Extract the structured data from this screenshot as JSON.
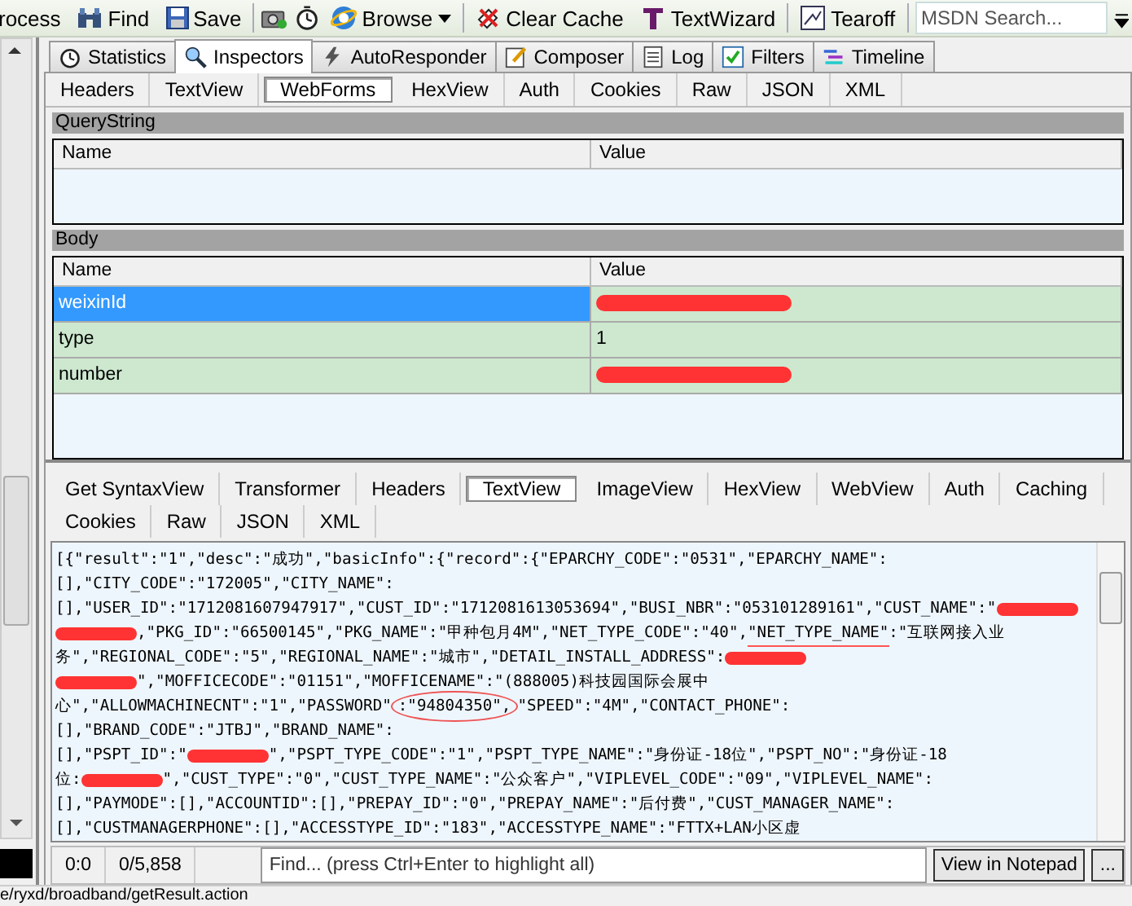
{
  "toolbar": [
    {
      "kind": "button",
      "label": "rocess"
    },
    {
      "kind": "button",
      "label": "Find"
    },
    {
      "kind": "button",
      "label": "Save"
    },
    {
      "kind": "icon"
    },
    {
      "kind": "icon"
    },
    {
      "kind": "dropdown",
      "label": "Browse"
    },
    {
      "kind": "button",
      "label": "Clear Cache"
    },
    {
      "kind": "button",
      "label": "TextWizard"
    },
    {
      "kind": "button",
      "label": "Tearoff"
    },
    {
      "kind": "search",
      "placeholder": "MSDN Search..."
    }
  ],
  "main_tabs": [
    {
      "label": "Statistics",
      "selected": false
    },
    {
      "label": "Inspectors",
      "selected": true
    },
    {
      "label": "AutoResponder",
      "selected": false
    },
    {
      "label": "Composer",
      "selected": false
    },
    {
      "label": "Log",
      "selected": false
    },
    {
      "label": "Filters",
      "selected": false
    },
    {
      "label": "Timeline",
      "selected": false
    }
  ],
  "request": {
    "tabs": [
      {
        "label": "Headers",
        "selected": false
      },
      {
        "label": "TextView",
        "selected": false
      },
      {
        "label": "WebForms",
        "selected": true
      },
      {
        "label": "HexView",
        "selected": false
      },
      {
        "label": "Auth",
        "selected": false
      },
      {
        "label": "Cookies",
        "selected": false
      },
      {
        "label": "Raw",
        "selected": false
      },
      {
        "label": "JSON",
        "selected": false
      },
      {
        "label": "XML",
        "selected": false
      }
    ],
    "querystring": {
      "title": "QueryString",
      "columns": [
        "Name",
        "Value"
      ]
    },
    "body": {
      "title": "Body",
      "columns": [
        "Name",
        "Value"
      ],
      "rows": [
        {
          "name": "weixinId",
          "value_redacted": true,
          "selected": true
        },
        {
          "name": "type",
          "value": "1",
          "value_redacted": false,
          "selected": false
        },
        {
          "name": "number",
          "value_redacted": true,
          "selected": false
        }
      ]
    }
  },
  "response": {
    "tabs": [
      [
        {
          "label": "Get SyntaxView",
          "selected": false
        },
        {
          "label": "Transformer",
          "selected": false
        },
        {
          "label": "Headers",
          "selected": false
        },
        {
          "label": "TextView",
          "selected": true
        },
        {
          "label": "ImageView",
          "selected": false
        },
        {
          "label": "HexView",
          "selected": false
        },
        {
          "label": "WebView",
          "selected": false
        },
        {
          "label": "Auth",
          "selected": false
        },
        {
          "label": "Caching",
          "selected": false
        }
      ],
      [
        {
          "label": "Cookies",
          "selected": false
        },
        {
          "label": "Raw",
          "selected": false
        },
        {
          "label": "JSON",
          "selected": false
        },
        {
          "label": "XML",
          "selected": false
        }
      ]
    ],
    "lines": [
      [
        {
          "kind": "text",
          "text": "[{\"result\":\"1\",\"desc\":\"成功\",\"basicInfo\":{\"record\":{\"EPARCHY_CODE\":\"0531\",\"EPARCHY_NAME\":"
        }
      ],
      [
        {
          "kind": "text",
          "text": "[],\"CITY_CODE\":\"172005\",\"CITY_NAME\":"
        }
      ],
      [
        {
          "kind": "text",
          "text": "[],\"USER_ID\":\"1712081607947917\",\"CUST_ID\":\"1712081613053694\",\"BUSI_NBR\":\"053101289161\",\"CUST_NAME\":\""
        },
        {
          "kind": "redaction"
        }
      ],
      [
        {
          "kind": "redaction"
        },
        {
          "kind": "text",
          "text": ",\"PKG_ID\":\"66500145\",\"PKG_NAME\":\"甲种包月4M\",\"NET_TYPE_CODE\":\"40\","
        },
        {
          "kind": "underlined",
          "text": "\"NET_TYPE_NAME\""
        },
        {
          "kind": "text",
          "text": ":\"互联网接入业"
        }
      ],
      [
        {
          "kind": "text",
          "text": "务\",\"REGIONAL_CODE\":\"5\",\"REGIONAL_NAME\":\"城市\",\"DETAIL_INSTALL_ADDRESS\":"
        },
        {
          "kind": "redaction"
        }
      ],
      [
        {
          "kind": "redaction"
        },
        {
          "kind": "text",
          "text": "\",\"MOFFICECODE\":\"01151\",\"MOFFICENAME\":\"(888005)科技园国际会展中"
        }
      ],
      [
        {
          "kind": "text",
          "text": "心\",\"ALLOWMACHINECNT\":\"1\",\"PASSWORD\""
        },
        {
          "kind": "circled",
          "text": ":\"94804350\","
        },
        {
          "kind": "text",
          "text": "\"SPEED\":\"4M\",\"CONTACT_PHONE\":"
        }
      ],
      [
        {
          "kind": "text",
          "text": "[],\"BRAND_CODE\":\"JTBJ\",\"BRAND_NAME\":"
        }
      ],
      [
        {
          "kind": "text",
          "text": "[],\"PSPT_ID\":\""
        },
        {
          "kind": "redaction"
        },
        {
          "kind": "text",
          "text": "\",\"PSPT_TYPE_CODE\":\"1\",\"PSPT_TYPE_NAME\":\"身份证-18位\",\"PSPT_NO\":\"身份证-18"
        }
      ],
      [
        {
          "kind": "text",
          "text": "位:"
        },
        {
          "kind": "redaction"
        },
        {
          "kind": "text",
          "text": "\",\"CUST_TYPE\":\"0\",\"CUST_TYPE_NAME\":\"公众客户\",\"VIPLEVEL_CODE\":\"09\",\"VIPLEVEL_NAME\":"
        }
      ],
      [
        {
          "kind": "text",
          "text": "[],\"PAYMODE\":[],\"ACCOUNTID\":[],\"PREPAY_ID\":\"0\",\"PREPAY_NAME\":\"后付费\",\"CUST_MANAGER_NAME\":"
        }
      ],
      [
        {
          "kind": "text",
          "text": "[],\"CUSTMANAGERPHONE\":[],\"ACCESSTYPE_ID\":\"183\",\"ACCESSTYPE_NAME\":\"FTTX+LAN小区虚"
        }
      ]
    ],
    "position": "0:0",
    "count": "0/5,858",
    "find": {
      "placeholder": "Find... (press Ctrl+Enter to highlight all)"
    },
    "buttons": [
      "View in Notepad",
      "..."
    ]
  },
  "status_bar": "e/ryxd/broadband/getResult.action"
}
